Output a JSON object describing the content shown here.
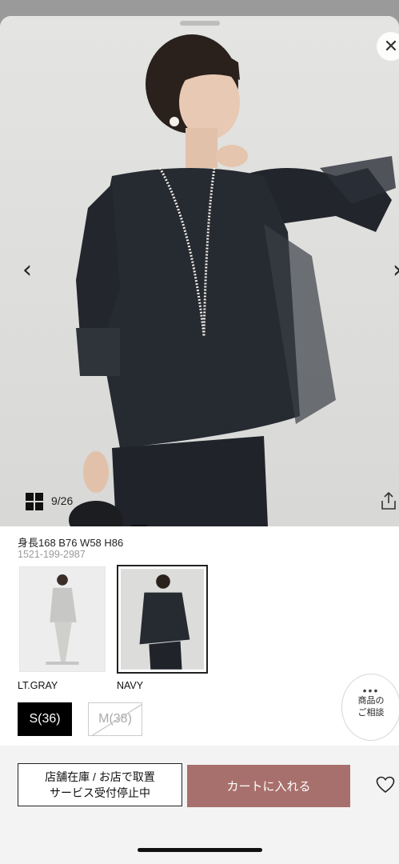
{
  "icons": {
    "close": "✕",
    "prev": "‹",
    "next": "›",
    "dots": "•••",
    "grid": "grid-icon",
    "share": "share-icon",
    "heart": "heart-icon"
  },
  "carousel": {
    "counter": "9/26"
  },
  "product": {
    "model_info": "身長168 B76 W58 H86",
    "code": "1521-199-2987"
  },
  "colors": [
    {
      "label": "LT.GRAY",
      "selected": false
    },
    {
      "label": "NAVY",
      "selected": true
    }
  ],
  "sizes": [
    {
      "label": "S(36)",
      "selected": true,
      "available": true
    },
    {
      "label": "M(38)",
      "selected": false,
      "available": false
    }
  ],
  "consult": {
    "line1": "商品の",
    "line2": "ご相談"
  },
  "actions": {
    "store_line1": "店舗在庫 / お店で取置",
    "store_line2": "サービス受付停止中",
    "cart": "カートに入れる"
  },
  "theme": {
    "cart_color": "#a8706c",
    "selected_size_bg": "#000000"
  }
}
